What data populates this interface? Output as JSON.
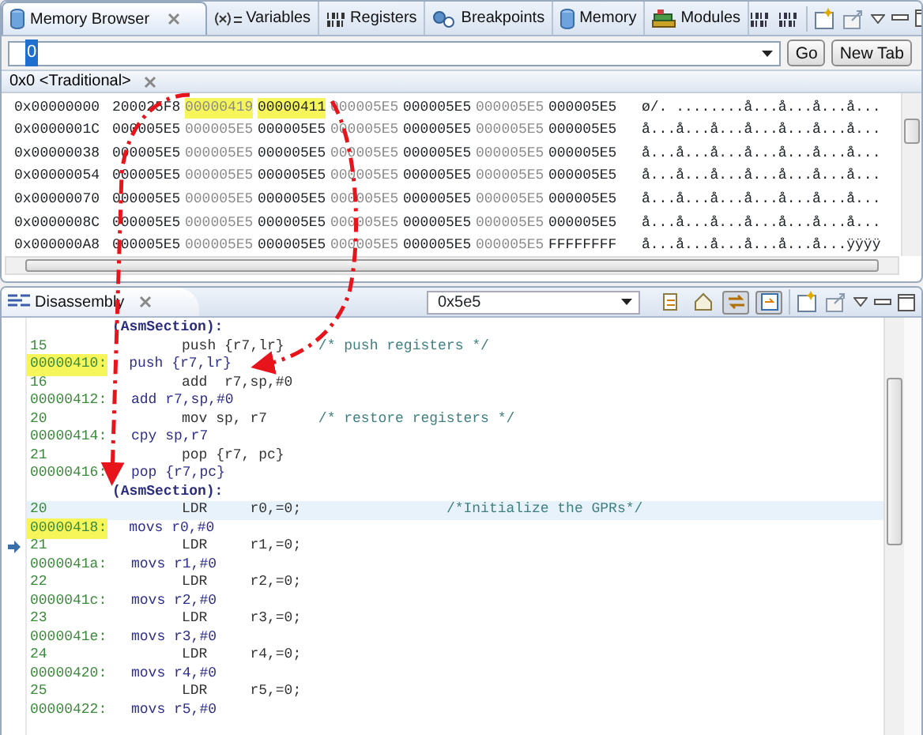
{
  "memory_browser": {
    "tabs": [
      {
        "label": "Memory Browser",
        "selected": true
      },
      {
        "label": "Variables",
        "selected": false
      },
      {
        "label": "Registers",
        "selected": false
      },
      {
        "label": "Breakpoints",
        "selected": false
      },
      {
        "label": "Memory",
        "selected": false
      },
      {
        "label": "Modules",
        "selected": false
      }
    ],
    "address_field": {
      "value": "0"
    },
    "buttons": [
      "Go",
      "New Tab"
    ],
    "rendering_tab": {
      "label": "0x0 <Traditional>"
    },
    "rows": [
      {
        "address": "0x00000000",
        "cells": [
          {
            "value": "200025F8",
            "highlighted": false
          },
          {
            "value": "00000419",
            "highlighted": true
          },
          {
            "value": "00000411",
            "highlighted": true
          },
          {
            "value": "000005E5",
            "highlighted": false
          },
          {
            "value": "000005E5",
            "highlighted": false
          },
          {
            "value": "000005E5",
            "highlighted": false
          },
          {
            "value": "000005E5",
            "highlighted": false
          }
        ],
        "ascii": "ø/. ........å...å...å...å..."
      },
      {
        "address": "0x0000001C",
        "cells": [
          {
            "value": "000005E5",
            "highlighted": false
          },
          {
            "value": "000005E5",
            "highlighted": false
          },
          {
            "value": "000005E5",
            "highlighted": false
          },
          {
            "value": "000005E5",
            "highlighted": false
          },
          {
            "value": "000005E5",
            "highlighted": false
          },
          {
            "value": "000005E5",
            "highlighted": false
          },
          {
            "value": "000005E5",
            "highlighted": false
          }
        ],
        "ascii": "å...å...å...å...å...å...å..."
      },
      {
        "address": "0x00000038",
        "cells": [
          {
            "value": "000005E5",
            "highlighted": false
          },
          {
            "value": "000005E5",
            "highlighted": false
          },
          {
            "value": "000005E5",
            "highlighted": false
          },
          {
            "value": "000005E5",
            "highlighted": false
          },
          {
            "value": "000005E5",
            "highlighted": false
          },
          {
            "value": "000005E5",
            "highlighted": false
          },
          {
            "value": "000005E5",
            "highlighted": false
          }
        ],
        "ascii": "å...å...å...å...å...å...å..."
      },
      {
        "address": "0x00000054",
        "cells": [
          {
            "value": "000005E5",
            "highlighted": false
          },
          {
            "value": "000005E5",
            "highlighted": false
          },
          {
            "value": "000005E5",
            "highlighted": false
          },
          {
            "value": "000005E5",
            "highlighted": false
          },
          {
            "value": "000005E5",
            "highlighted": false
          },
          {
            "value": "000005E5",
            "highlighted": false
          },
          {
            "value": "000005E5",
            "highlighted": false
          }
        ],
        "ascii": "å...å...å...å...å...å...å..."
      },
      {
        "address": "0x00000070",
        "cells": [
          {
            "value": "000005E5",
            "highlighted": false
          },
          {
            "value": "000005E5",
            "highlighted": false
          },
          {
            "value": "000005E5",
            "highlighted": false
          },
          {
            "value": "000005E5",
            "highlighted": false
          },
          {
            "value": "000005E5",
            "highlighted": false
          },
          {
            "value": "000005E5",
            "highlighted": false
          },
          {
            "value": "000005E5",
            "highlighted": false
          }
        ],
        "ascii": "å...å...å...å...å...å...å..."
      },
      {
        "address": "0x0000008C",
        "cells": [
          {
            "value": "000005E5",
            "highlighted": false
          },
          {
            "value": "000005E5",
            "highlighted": false
          },
          {
            "value": "000005E5",
            "highlighted": false
          },
          {
            "value": "000005E5",
            "highlighted": false
          },
          {
            "value": "000005E5",
            "highlighted": false
          },
          {
            "value": "000005E5",
            "highlighted": false
          },
          {
            "value": "000005E5",
            "highlighted": false
          }
        ],
        "ascii": "å...å...å...å...å...å...å..."
      },
      {
        "address": "0x000000A8",
        "cells": [
          {
            "value": "000005E5",
            "highlighted": false
          },
          {
            "value": "000005E5",
            "highlighted": false
          },
          {
            "value": "000005E5",
            "highlighted": false
          },
          {
            "value": "000005E5",
            "highlighted": false
          },
          {
            "value": "000005E5",
            "highlighted": false
          },
          {
            "value": "000005E5",
            "highlighted": false
          },
          {
            "value": "FFFFFFFF",
            "highlighted": false
          }
        ],
        "ascii": "å...å...å...å...å...å...ÿÿÿÿ"
      }
    ]
  },
  "disassembly": {
    "tab": {
      "label": "Disassembly"
    },
    "address_combo": {
      "value": "0x5e5"
    },
    "toolbar_toggles": [
      {
        "pressed": false
      },
      {
        "pressed": false
      },
      {
        "pressed": true
      },
      {
        "pressed": true
      }
    ],
    "lines": [
      {
        "kind": "section",
        "text": "(AsmSection):"
      },
      {
        "kind": "source",
        "line": "15",
        "code": "push {r7,lr}    /* push registers */",
        "current": false,
        "pc": false
      },
      {
        "kind": "instruction",
        "address": "00000410:",
        "text": "push {r7,lr}",
        "highlighted": true
      },
      {
        "kind": "source",
        "line": "16",
        "code": "add  r7,sp,#0",
        "current": false,
        "pc": false
      },
      {
        "kind": "instruction",
        "address": "00000412:",
        "text": "add r7,sp,#0",
        "highlighted": false
      },
      {
        "kind": "source",
        "line": "20",
        "code": "mov sp, r7      /* restore registers */",
        "current": false,
        "pc": false
      },
      {
        "kind": "instruction",
        "address": "00000414:",
        "text": "cpy sp,r7",
        "highlighted": false
      },
      {
        "kind": "source",
        "line": "21",
        "code": "pop {r7, pc}",
        "current": false,
        "pc": false
      },
      {
        "kind": "instruction",
        "address": "00000416:",
        "text": "pop {r7,pc}",
        "highlighted": false
      },
      {
        "kind": "section",
        "text": "(AsmSection):"
      },
      {
        "kind": "source",
        "line": "20",
        "code": "LDR     r0,=0;                 /*Initialize the GPRs*/",
        "current": true,
        "pc": false
      },
      {
        "kind": "instruction",
        "address": "00000418:",
        "text": "movs r0,#0",
        "highlighted": true
      },
      {
        "kind": "source",
        "line": "21",
        "code": "LDR     r1,=0;",
        "current": false,
        "pc": true
      },
      {
        "kind": "instruction",
        "address": "0000041a:",
        "text": "movs r1,#0",
        "highlighted": false
      },
      {
        "kind": "source",
        "line": "22",
        "code": "LDR     r2,=0;",
        "current": false,
        "pc": false
      },
      {
        "kind": "instruction",
        "address": "0000041c:",
        "text": "movs r2,#0",
        "highlighted": false
      },
      {
        "kind": "source",
        "line": "23",
        "code": "LDR     r3,=0;",
        "current": false,
        "pc": false
      },
      {
        "kind": "instruction",
        "address": "0000041e:",
        "text": "movs r3,#0",
        "highlighted": false
      },
      {
        "kind": "source",
        "line": "24",
        "code": "LDR     r4,=0;",
        "current": false,
        "pc": false
      },
      {
        "kind": "instruction",
        "address": "00000420:",
        "text": "movs r4,#0",
        "highlighted": false
      },
      {
        "kind": "source",
        "line": "25",
        "code": "LDR     r5,=0;",
        "current": false,
        "pc": false
      },
      {
        "kind": "instruction",
        "address": "00000422:",
        "text": "movs r5,#0",
        "highlighted": false
      }
    ]
  }
}
